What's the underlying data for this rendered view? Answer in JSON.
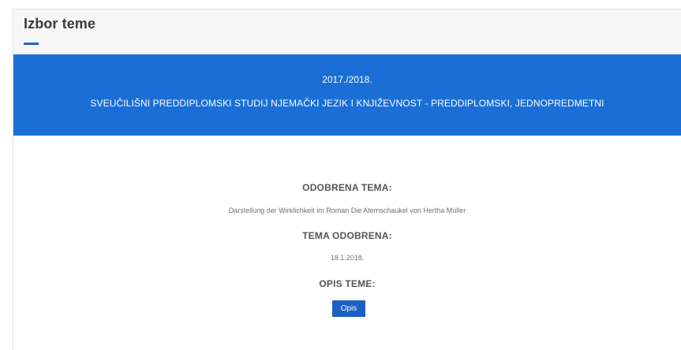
{
  "header": {
    "title": "Izbor teme"
  },
  "banner": {
    "year": "2017./2018.",
    "program": "SVEUČILIŠNI PREDDIPLOMSKI STUDIJ NJEMAČKI JEZIK I KNJIŽEVNOST - PREDDIPLOMSKI, JEDNOPREDMETNI"
  },
  "topic": {
    "approved_topic_label": "ODOBRENA TEMA:",
    "approved_topic_value": "Darstellung der Wirklichkeit im Roman Die Atemschaukel von Hertha Müller",
    "approved_date_label": "TEMA ODOBRENA:",
    "approved_date_value": "18.1.2018.",
    "description_label": "OPIS TEME:",
    "description_button": "Opis"
  },
  "colors": {
    "accent": "#1a6ed6",
    "button": "#1a5fc4",
    "header_bg": "#f7f7f7"
  }
}
